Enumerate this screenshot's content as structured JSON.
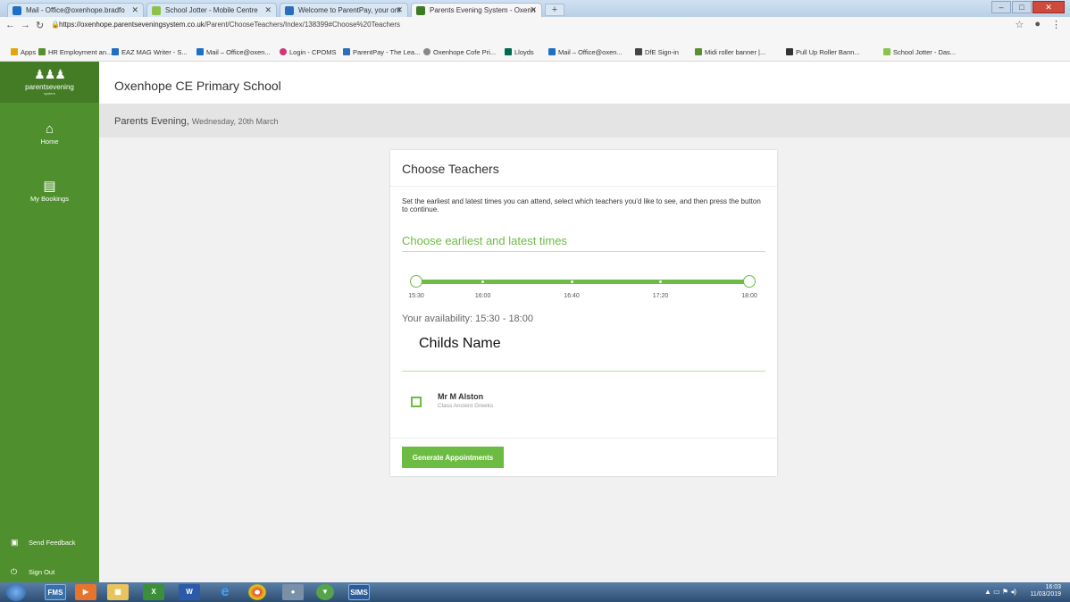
{
  "browser": {
    "tabs": [
      {
        "label": "Mail - Office@oxenhope.bradfo",
        "color": "#1f6fc5",
        "active": false
      },
      {
        "label": "School Jotter - Mobile Centre",
        "color": "#8bc34a",
        "active": false
      },
      {
        "label": "Welcome to ParentPay, your onl",
        "color": "#2a6fb8",
        "active": false
      },
      {
        "label": "Parents Evening System - Oxenh",
        "color": "#3c7a24",
        "active": true
      }
    ],
    "new_tab": "+",
    "url_host": "https://oxenhope.parentseveningsystem.co.uk",
    "url_path": "/Parent/ChooseTeachers/Index/138399#Choose%20Teachers",
    "bookmarks": [
      {
        "label": "Apps",
        "color": "#e5a50a"
      },
      {
        "label": "HR Employment an...",
        "color": "#5b8f2e"
      },
      {
        "label": "EAZ MAG Writer - S...",
        "color": "#1f6fc5"
      },
      {
        "label": "Mail – Office@oxen...",
        "color": "#1f6fc5"
      },
      {
        "label": "Login - CPOMS",
        "color": "#d0357a"
      },
      {
        "label": "ParentPay - The Lea...",
        "color": "#2a6fb8"
      },
      {
        "label": "Oxenhope Cofe Pri...",
        "color": "#888888"
      },
      {
        "label": "Lloyds",
        "color": "#006a4d"
      },
      {
        "label": "Mail – Office@oxen...",
        "color": "#1f6fc5"
      },
      {
        "label": "DfE Sign-in",
        "color": "#444444"
      },
      {
        "label": "Midi roller banner |...",
        "color": "#5b8f2e"
      },
      {
        "label": "Pull Up Roller Bann...",
        "color": "#333333"
      },
      {
        "label": "School Jotter - Das...",
        "color": "#8bc34a"
      }
    ]
  },
  "sidebar": {
    "logo_text": "parentsevening",
    "logo_sub": "system",
    "items": [
      {
        "label": "Home",
        "icon": "home-icon"
      },
      {
        "label": "My Bookings",
        "icon": "document-icon"
      }
    ],
    "send_feedback": "Send Feedback",
    "sign_out": "Sign Out"
  },
  "header": {
    "school": "Oxenhope CE Primary School",
    "event": "Parents Evening,",
    "event_date": "Wednesday, 20th March"
  },
  "card": {
    "title": "Choose Teachers",
    "intro": "Set the earliest and latest times you can attend, select which teachers you'd like to see, and then press the button to continue.",
    "times_heading": "Choose earliest and latest times",
    "slider": {
      "ticks": [
        "15:30",
        "16:00",
        "16:40",
        "17:20",
        "18:00"
      ],
      "min": "15:30",
      "max": "18:00",
      "selected_start": "15:30",
      "selected_end": "18:00"
    },
    "availability": "Your availability: 15:30 - 18:00",
    "child_name": "Childs Name",
    "teachers": [
      {
        "name": "Mr M Alston",
        "class": "Class Ancient Greeks",
        "checked": false
      }
    ],
    "button": "Generate Appointments"
  },
  "taskbar": {
    "time": "16:03",
    "date": "11/03/2019",
    "apps": [
      "FMS",
      "SIMS"
    ]
  },
  "colors": {
    "sidebar": "#4f8f2d",
    "accent": "#6cbb42"
  }
}
